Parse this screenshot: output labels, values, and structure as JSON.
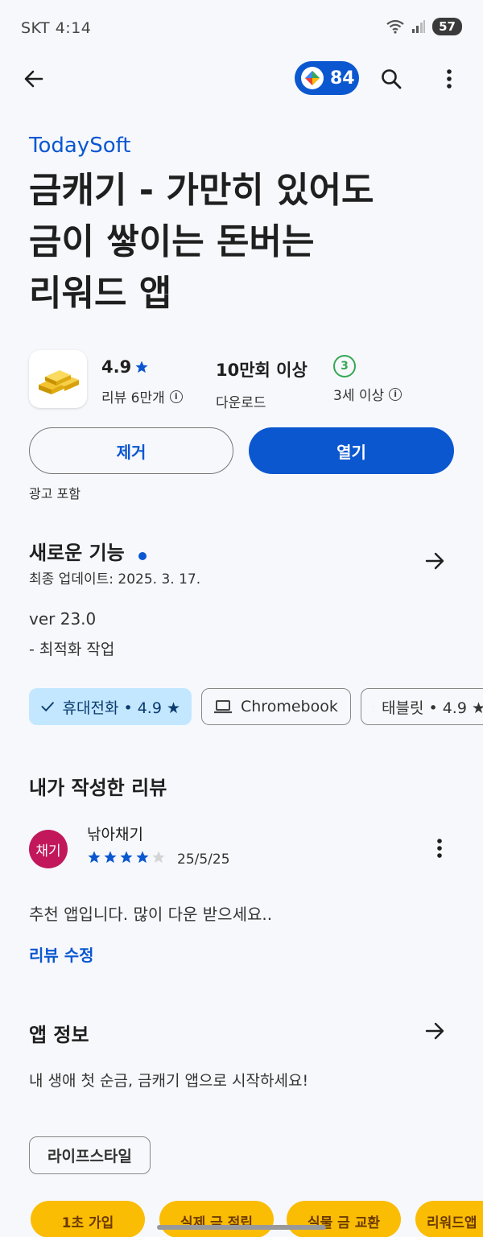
{
  "status_bar": {
    "carrier": "SKT",
    "time": "4:14",
    "battery": "57"
  },
  "header": {
    "points": "84"
  },
  "app": {
    "developer": "TodaySoft",
    "title_line1": "금캐기 - 가만히 있어도",
    "title_line2": "금이 쌓이는 돈버는",
    "title_line3": "리워드 앱",
    "rating": "4.9",
    "reviews_count": "리뷰 6만개",
    "downloads": "10만회 이상",
    "downloads_label": "다운로드",
    "age_badge": "3",
    "age_label": "3세 이상",
    "remove_label": "제거",
    "open_label": "열기",
    "ads_note": "광고 포함"
  },
  "whats_new": {
    "title": "새로운 기능",
    "updated": "최종 업데이트: 2025. 3. 17.",
    "version": "ver 23.0",
    "note": "- 최적화 작업"
  },
  "devices": [
    {
      "label": "휴대전화 • 4.9 ★",
      "selected": true
    },
    {
      "label": "Chromebook",
      "selected": false
    },
    {
      "label": "태블릿 • 4.9 ★",
      "selected": false
    }
  ],
  "my_review": {
    "title": "내가 작성한 리뷰",
    "avatar_text": "채기",
    "author": "낚아채기",
    "stars": 4,
    "date": "25/5/25",
    "text": "추천 앱입니다. 많이 다운 받으세요..",
    "edit_label": "리뷰 수정"
  },
  "app_info": {
    "title": "앱 정보",
    "description": "내 생애 첫 순금, 금캐기 앱으로 시작하세요!",
    "category": "라이프스타일"
  },
  "promo_tags": [
    "1초 가입",
    "실제 금 적립",
    "실물 금 교환",
    "리워드앱"
  ],
  "colors": {
    "accent": "#0b57d0",
    "avatar": "#c2185b",
    "promo": "#fbbc04"
  }
}
